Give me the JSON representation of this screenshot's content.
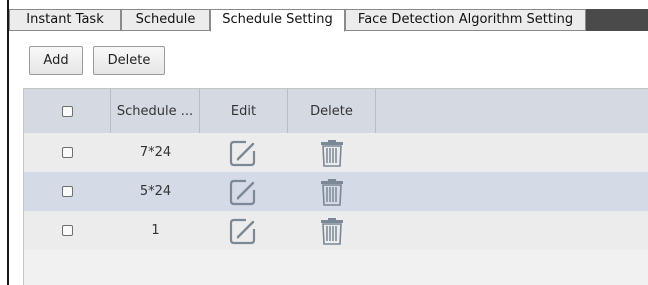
{
  "tabs": [
    {
      "label": "Instant Task",
      "active": false
    },
    {
      "label": "Schedule",
      "active": false
    },
    {
      "label": "Schedule Setting",
      "active": true
    },
    {
      "label": "Face Detection Algorithm Setting",
      "active": false
    }
  ],
  "toolbar": {
    "add_label": "Add",
    "delete_label": "Delete"
  },
  "table": {
    "columns": [
      "",
      "Schedule ...",
      "Edit",
      "Delete"
    ],
    "rows": [
      {
        "schedule": "7*24",
        "selected": false
      },
      {
        "schedule": "5*24",
        "selected": false
      },
      {
        "schedule": "1",
        "selected": false
      }
    ]
  },
  "icons": {
    "edit": "edit-icon",
    "delete": "trash-icon"
  },
  "colors": {
    "header_bg": "#d4d9e2",
    "row_bg": "#ececec",
    "row_highlight_bg": "#d4dbe7",
    "icon_color": "#7b8896"
  }
}
